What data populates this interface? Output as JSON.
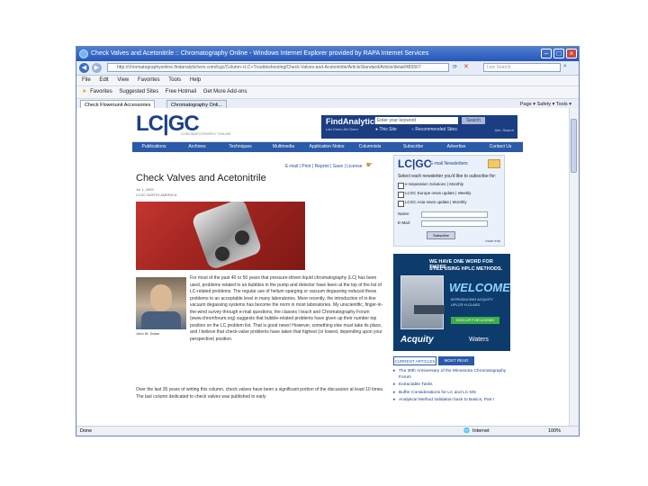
{
  "browser": {
    "title": "Check Valves and Acetonitrile :: Chromatography Online - Windows Internet Explorer provided by RAPA Internet Services",
    "address": "http://chromatographyonline.findanalytichem.com/lcgc/Column:+LC+Troubleshooting/Check-Valves-and-Acetonitrile/ArticleStandard/Article/detail/483567",
    "search_placeholder": "Live Search",
    "menu": [
      "File",
      "Edit",
      "View",
      "Favorites",
      "Tools",
      "Help"
    ],
    "favorites_bar": [
      "Favorites",
      "Suggested Sites",
      "Free Hotmail",
      "Get More Add-ons"
    ],
    "tabs": [
      "Check Flowrounit Accessories",
      "Chromatography Onli..."
    ],
    "tab_tools": "Page ▾  Safety ▾  Tools ▾",
    "status_left": "Done",
    "status_right": "Internet",
    "zoom": "100%"
  },
  "site": {
    "logo": "LC|GC",
    "tagline": "CHROMATOGRAPHY ONLINE",
    "findanalytichem": {
      "name": "FindAnalytichem",
      "sub": "Lab Chem  Alt Chem",
      "keyword_placeholder": "Enter your keyword",
      "search_button": "Search",
      "options": [
        "This Site",
        "Recommended Sites"
      ],
      "advanced": "Adv. Search"
    },
    "nav": [
      "Publications",
      "Archives",
      "Techniques",
      "Multimedia",
      "Application Notes",
      "Columnists",
      "Subscribe",
      "Advertise",
      "Contact Us"
    ]
  },
  "article": {
    "tools": "E-mail | Print | Reprint | Save | License",
    "title": "Check Valves and Acetonitrile",
    "date": "Jul 1, 2009",
    "section": "LCGC NORTH AMERICA",
    "author_caption": "John W. Dolan",
    "paragraph1": "For most of the past 40 or 50 years that pressure-driven liquid chromatography (LC) has been used, problems related to air bubbles in the pump and detector have been at the top of the list of LC-related problems. The regular use of helium sparging or vacuum degassing reduced these problems to an acceptable level in many laboratories. More recently, the introduction of in-line vacuum degassing systems has become the norm in most laboratories. My unscientific, finger-in-the-wind survey through e-mail questions, the classes I teach and Chromatography Forum (www.chromforum.org) suggests that bubble-related problems have given up their number top position on the LC problem list. That is good news! However, something else must take its place, and I believe that check-valve problems have taken that highest (or lowest, depending upon your perspective) position.",
    "paragraph2": "Over the last 35 years of writing this column, check valves have been a significant portion of the discussion at least 10 times. The last column dedicated to check valves was published in early"
  },
  "newsletter": {
    "logo": "LC|GC",
    "label": "E-mail Newsletters",
    "prompt": "Select each newsletter you'd like to subscribe for:",
    "options": [
      "e-Separation Solutions | Monthly",
      "LCGC Europe news update | Weekly",
      "LCGC Asia news update | Monthly"
    ],
    "name_label": "Name:",
    "email_label": "E-Mail:",
    "submit": "Subscribe",
    "more": "more info"
  },
  "ad": {
    "line1": "WE HAVE ONE WORD FOR THOSE",
    "line2": "STILL USING HPLC METHODS.",
    "welcome": "WELCOME.",
    "intro": "INTRODUCING ACQUITY UPLC® H-CLASS.",
    "button": "SIGN UP FOR A DEMO",
    "brand": "Acquity",
    "maker": "Waters"
  },
  "related": {
    "tabs": [
      "CURRENT ARTICLES",
      "MOST READ"
    ],
    "items": [
      "The 30th Anniversary of the Minnesota Chromatography Forum",
      "Extractable Tasks",
      "Buffer Considerations for LC and LC-MS",
      "Analytical Method Validation back to Basics, Part I"
    ]
  }
}
